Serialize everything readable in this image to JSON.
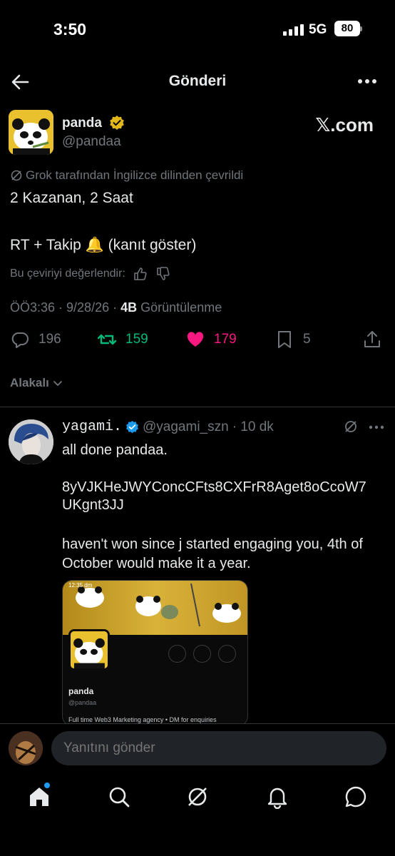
{
  "status_bar": {
    "time": "3:50",
    "network": "5G",
    "battery": "80"
  },
  "header": {
    "title": "Gönderi"
  },
  "post": {
    "author_name": "panda",
    "author_handle": "@pandaa",
    "source_label": "𝕏.com",
    "translated_note": "Grok tarafından İngilizce dilinden çevrildi",
    "line1": "2 Kazanan, 2 Saat",
    "line2": "RT + Takip 🔔 (kanıt göster)",
    "rate_label": "Bu çeviriyi değerlendir:",
    "time": "ÖÖ3:36 · 9/28/26 ·",
    "views_count": "4B",
    "views_label": "Görüntülenme",
    "replies": "196",
    "reposts": "159",
    "likes": "179",
    "bookmarks": "5"
  },
  "related_label": "Alakalı",
  "reply": {
    "name": "yagami.",
    "handle": "@yagami_szn",
    "time": "· 10 dk",
    "line1": "all done pandaa.",
    "line2": "8yVJKHeJWYConcCFts8CXFrR8Aget8oCcoW7",
    "line3": "UKgnt3JJ",
    "line4": "haven't won since j started engaging you, 4th of",
    "line5": "October would make it a year.",
    "embed": {
      "status": "12:35 dm",
      "name": "panda",
      "handle": "@pandaa",
      "bio": "Full time Web3 Marketing agency • DM for enquiries"
    }
  },
  "reply_bar": {
    "placeholder": "Yanıtını gönder"
  },
  "colors": {
    "accent": "#1d9bf0",
    "repost": "#00ba7c",
    "like": "#f91880",
    "gold": "#e2b719"
  },
  "icons": [
    "back-arrow-icon",
    "more-icon",
    "grok-icon",
    "thumbs-up-icon",
    "thumbs-down-icon",
    "reply-icon",
    "repost-icon",
    "heart-icon",
    "bookmark-icon",
    "share-icon",
    "home-icon",
    "search-icon",
    "notifications-icon",
    "messages-icon"
  ]
}
